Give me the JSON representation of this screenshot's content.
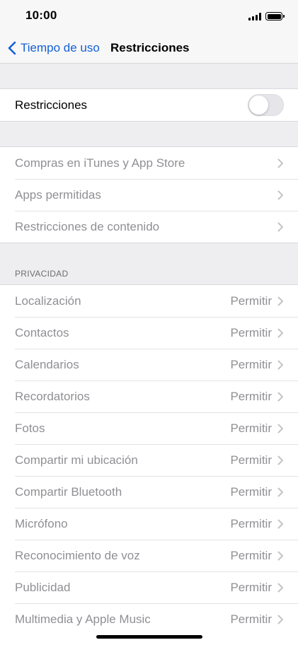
{
  "status_bar": {
    "time": "10:00"
  },
  "nav": {
    "back_label": "Tiempo de uso",
    "title": "Restricciones"
  },
  "restrictions_toggle": {
    "label": "Restricciones",
    "state": "off"
  },
  "store_group": [
    {
      "label": "Compras en iTunes y App Store"
    },
    {
      "label": "Apps permitidas"
    },
    {
      "label": "Restricciones de contenido"
    }
  ],
  "privacy": {
    "header": "PRIVACIDAD",
    "items": [
      {
        "label": "Localización",
        "value": "Permitir"
      },
      {
        "label": "Contactos",
        "value": "Permitir"
      },
      {
        "label": "Calendarios",
        "value": "Permitir"
      },
      {
        "label": "Recordatorios",
        "value": "Permitir"
      },
      {
        "label": "Fotos",
        "value": "Permitir"
      },
      {
        "label": "Compartir mi ubicación",
        "value": "Permitir"
      },
      {
        "label": "Compartir Bluetooth",
        "value": "Permitir"
      },
      {
        "label": "Micrófono",
        "value": "Permitir"
      },
      {
        "label": "Reconocimiento de voz",
        "value": "Permitir"
      },
      {
        "label": "Publicidad",
        "value": "Permitir"
      },
      {
        "label": "Multimedia y Apple Music",
        "value": "Permitir"
      }
    ]
  },
  "colors": {
    "accent": "#1460d6",
    "disabled_text": "#909094",
    "background": "#eeeef1"
  }
}
